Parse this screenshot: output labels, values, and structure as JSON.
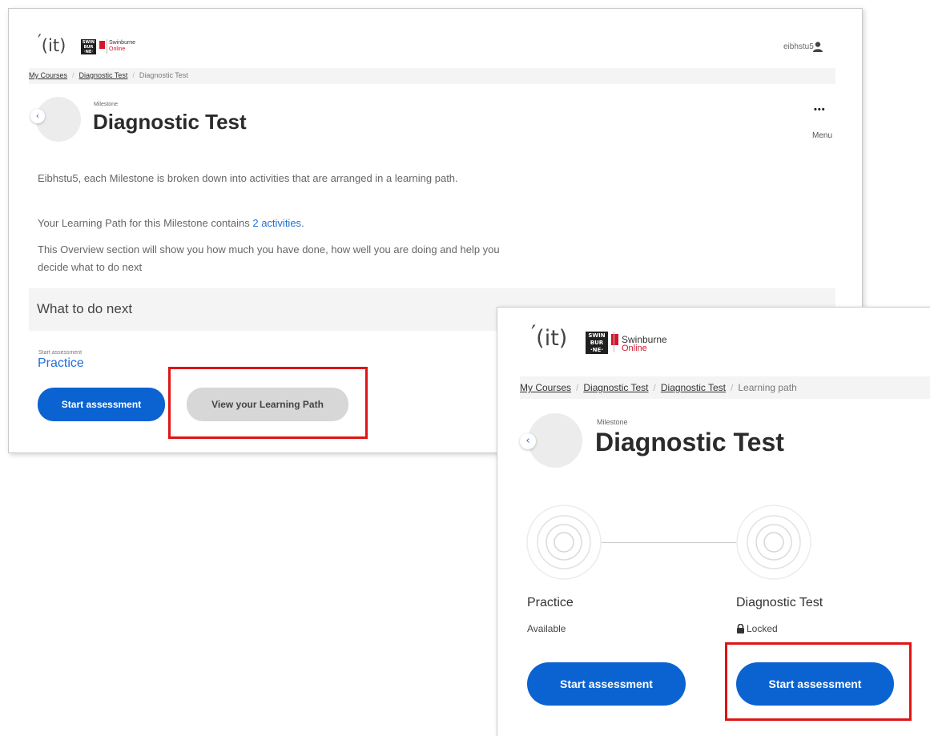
{
  "brand": {
    "it_logo": "it",
    "swinburne_box_lines": [
      "SWIN",
      "BUR",
      "·NE·"
    ],
    "swinburne_name": "Swinburne",
    "swinburne_online": "Online",
    "accent_red": "#d3162b"
  },
  "back_screen": {
    "username": "eibhstu5",
    "user_icon": "user-icon",
    "breadcrumb": [
      "My Courses",
      "Diagnostic Test",
      "Diagnostic Test"
    ],
    "milestone_label": "Milestone",
    "title": "Diagnostic Test",
    "menu_icon": "more-dots-icon",
    "menu_dots": "•••",
    "menu_label": "Menu",
    "para1": "Eibhstu5, each Milestone is broken down into activities that are arranged in a learning path.",
    "para2_prefix": "Your Learning Path for this Milestone contains ",
    "para2_link": "2 activities",
    "para2_suffix": ".",
    "para3": "This Overview section will show you how much you have done, how well you are doing and help you decide what to do next",
    "next_heading": "What to do next",
    "start_label": "Start assessment",
    "practice_link": "Practice",
    "start_button": "Start assessment",
    "learning_path_button": "View your Learning Path"
  },
  "front_screen": {
    "breadcrumb": [
      "My Courses",
      "Diagnostic Test",
      "Diagnostic Test",
      "Learning path"
    ],
    "milestone_label": "Milestone",
    "title": "Diagnostic Test",
    "activities": [
      {
        "title": "Practice",
        "status": "Available",
        "button": "Start assessment",
        "locked": false
      },
      {
        "title": "Diagnostic Test",
        "status": "Locked",
        "button": "Start assessment",
        "locked": true
      }
    ]
  },
  "colors": {
    "primary_button": "#0a63d1",
    "link": "#1e6fd9",
    "highlight": "#e01414"
  }
}
